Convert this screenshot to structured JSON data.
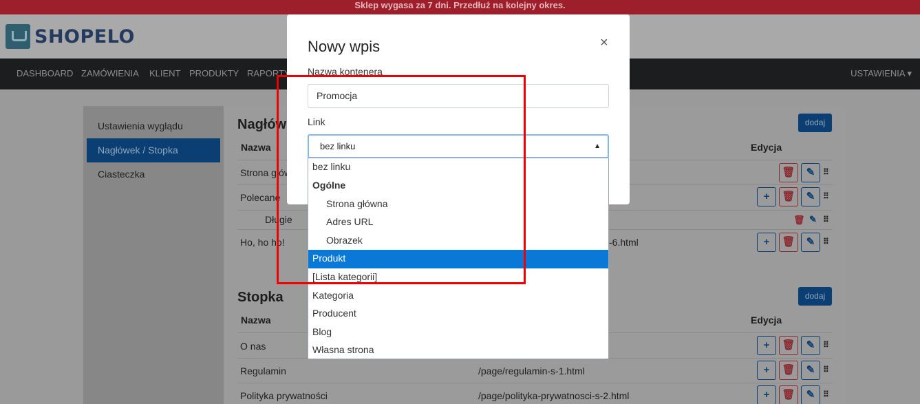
{
  "banner": {
    "text": "Sklep wygasa za 7 dni. Przedłuż na kolejny okres."
  },
  "logo": {
    "text": "SHOPELO"
  },
  "topnav": {
    "items": [
      "DASHBOARD",
      "ZAMÓWIENIA",
      "KLIENT",
      "PRODUKTY",
      "RAPORTY"
    ],
    "settings": "USTAWIENIA ▾"
  },
  "sidebar": {
    "items": [
      {
        "label": "Ustawienia wyglądu"
      },
      {
        "label": "Nagłówek / Stopka"
      },
      {
        "label": "Ciasteczka"
      }
    ]
  },
  "header_section": {
    "title": "Nagłów",
    "add_label": "dodaj",
    "col_name": "Nazwa",
    "col_edit": "Edycja",
    "rows": [
      {
        "name": "Strona główna",
        "link": ""
      },
      {
        "name": "Polecane",
        "link": ""
      },
      {
        "name": "Długie",
        "link": ""
      },
      {
        "name": "Ho, ho ho!",
        "link": "-6.html"
      }
    ]
  },
  "footer_section": {
    "title": "Stopka",
    "add_label": "dodaj",
    "col_name": "Nazwa",
    "col_edit": "Edycja",
    "rows": [
      {
        "name": "O nas",
        "link": ""
      },
      {
        "name": "Regulamin",
        "link": "/page/regulamin-s-1.html"
      },
      {
        "name": "Polityka prywatności",
        "link": "/page/polityka-prywatnosci-s-2.html"
      }
    ]
  },
  "modal": {
    "title": "Nowy wpis",
    "close": "×",
    "container_label": "Nazwa kontenera",
    "container_value": "Promocja",
    "link_label": "Link",
    "link_selected": "bez linku"
  },
  "dropdown": {
    "options": [
      {
        "label": "bez linku",
        "kind": "option"
      },
      {
        "label": "Ogólne",
        "kind": "group"
      },
      {
        "label": "Strona główna",
        "kind": "sub"
      },
      {
        "label": "Adres URL",
        "kind": "sub"
      },
      {
        "label": "Obrazek",
        "kind": "sub"
      },
      {
        "label": "Produkt",
        "kind": "selected"
      },
      {
        "label": "[Lista kategorii]",
        "kind": "option"
      },
      {
        "label": "Kategoria",
        "kind": "option"
      },
      {
        "label": "Producent",
        "kind": "option"
      },
      {
        "label": "Blog",
        "kind": "option"
      },
      {
        "label": "Własna strona",
        "kind": "option"
      }
    ]
  },
  "colors": {
    "banner": "#9c1f2b",
    "nav": "#1c1d1f",
    "selected_option": "#0a78d7",
    "annotation": "#ee0000"
  }
}
